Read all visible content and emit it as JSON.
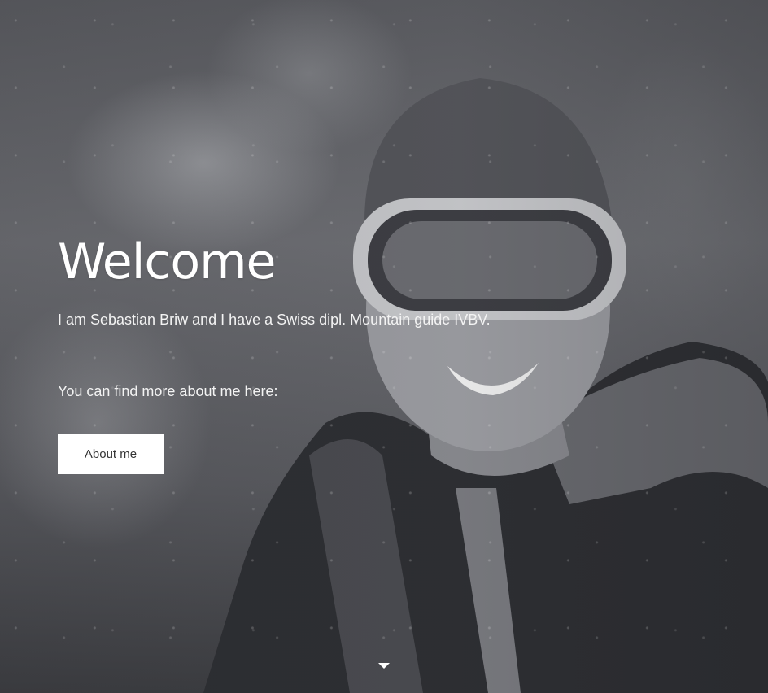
{
  "hero": {
    "title": "Welcome",
    "intro": "I am Sebastian Briw and I have a Swiss dipl. Mountain guide IVBV.",
    "more_text": "You can find more about me here:",
    "about_button_label": "About me"
  },
  "icons": {
    "scroll_down": "caret-down-icon"
  },
  "colors": {
    "text": "#ffffff",
    "button_bg": "#ffffff",
    "button_text": "#333333",
    "photo_tone": "#5f6065"
  }
}
